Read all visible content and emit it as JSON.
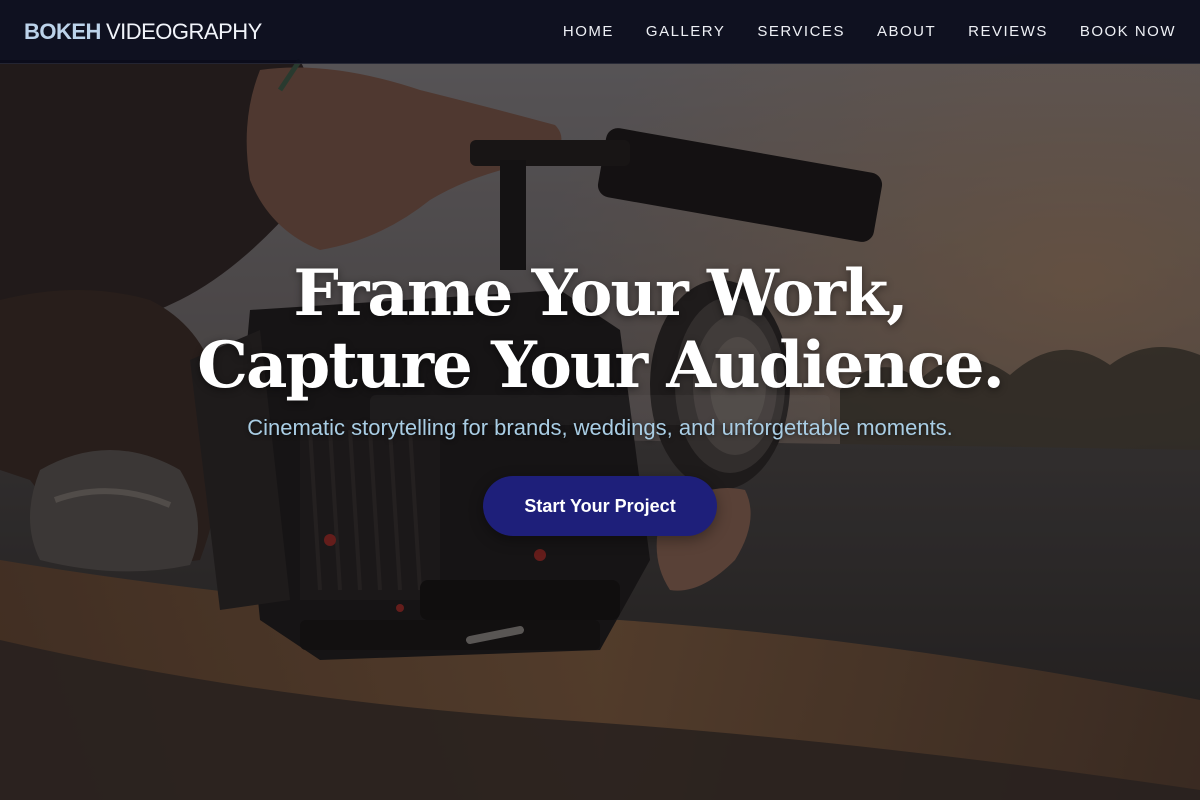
{
  "brand": {
    "name_strong": "BOKEH",
    "name_light": "VIDEOGRAPHY"
  },
  "nav": {
    "items": [
      {
        "label": "HOME"
      },
      {
        "label": "GALLERY"
      },
      {
        "label": "SERVICES"
      },
      {
        "label": "ABOUT"
      },
      {
        "label": "REVIEWS"
      },
      {
        "label": "BOOK NOW"
      }
    ]
  },
  "hero": {
    "headline_line1": "Frame Your Work,",
    "headline_line2": "Capture Your Audience.",
    "subtitle": "Cinematic storytelling for brands, weddings, and unforgettable moments.",
    "cta_label": "Start Your Project",
    "background_image": "person-adjusting-cinema-camera-on-ground"
  },
  "colors": {
    "nav_background": "#0a0c1c",
    "brand_accent": "#bcd3ea",
    "subtitle": "#a9cde4",
    "cta_background": "#1e1f7a",
    "cta_text": "#ffffff"
  }
}
